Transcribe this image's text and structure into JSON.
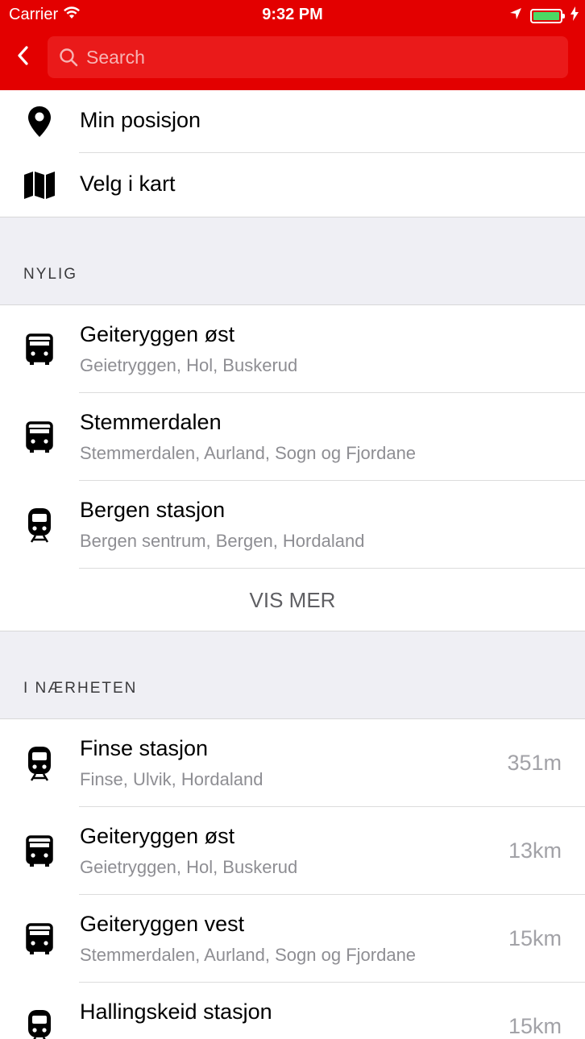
{
  "status_bar": {
    "carrier": "Carrier",
    "time": "9:32 PM"
  },
  "search": {
    "placeholder": "Search"
  },
  "quick_actions": [
    {
      "label": "Min posisjon",
      "icon": "location-pin-icon"
    },
    {
      "label": "Velg i kart",
      "icon": "map-icon"
    }
  ],
  "recent": {
    "header": "NYLIG",
    "items": [
      {
        "title": "Geiteryggen øst",
        "subtitle": "Geietryggen, Hol, Buskerud",
        "icon": "bus-icon"
      },
      {
        "title": "Stemmerdalen",
        "subtitle": "Stemmerdalen, Aurland, Sogn og Fjordane",
        "icon": "bus-icon"
      },
      {
        "title": "Bergen stasjon",
        "subtitle": "Bergen sentrum, Bergen, Hordaland",
        "icon": "train-icon"
      }
    ],
    "more_label": "VIS MER"
  },
  "nearby": {
    "header": "I NÆRHETEN",
    "items": [
      {
        "title": "Finse stasjon",
        "subtitle": "Finse, Ulvik, Hordaland",
        "distance": "351m",
        "icon": "train-icon"
      },
      {
        "title": "Geiteryggen øst",
        "subtitle": "Geietryggen, Hol, Buskerud",
        "distance": "13km",
        "icon": "bus-icon"
      },
      {
        "title": "Geiteryggen vest",
        "subtitle": "Stemmerdalen, Aurland, Sogn og Fjordane",
        "distance": "15km",
        "icon": "bus-icon"
      },
      {
        "title": "Hallingskeid stasjon",
        "subtitle": "",
        "distance": "15km",
        "icon": "train-icon"
      }
    ]
  },
  "colors": {
    "header_bg": "#e30000",
    "search_bg": "#ea1a1a",
    "section_bg": "#efeff4",
    "battery": "#4cd964"
  }
}
